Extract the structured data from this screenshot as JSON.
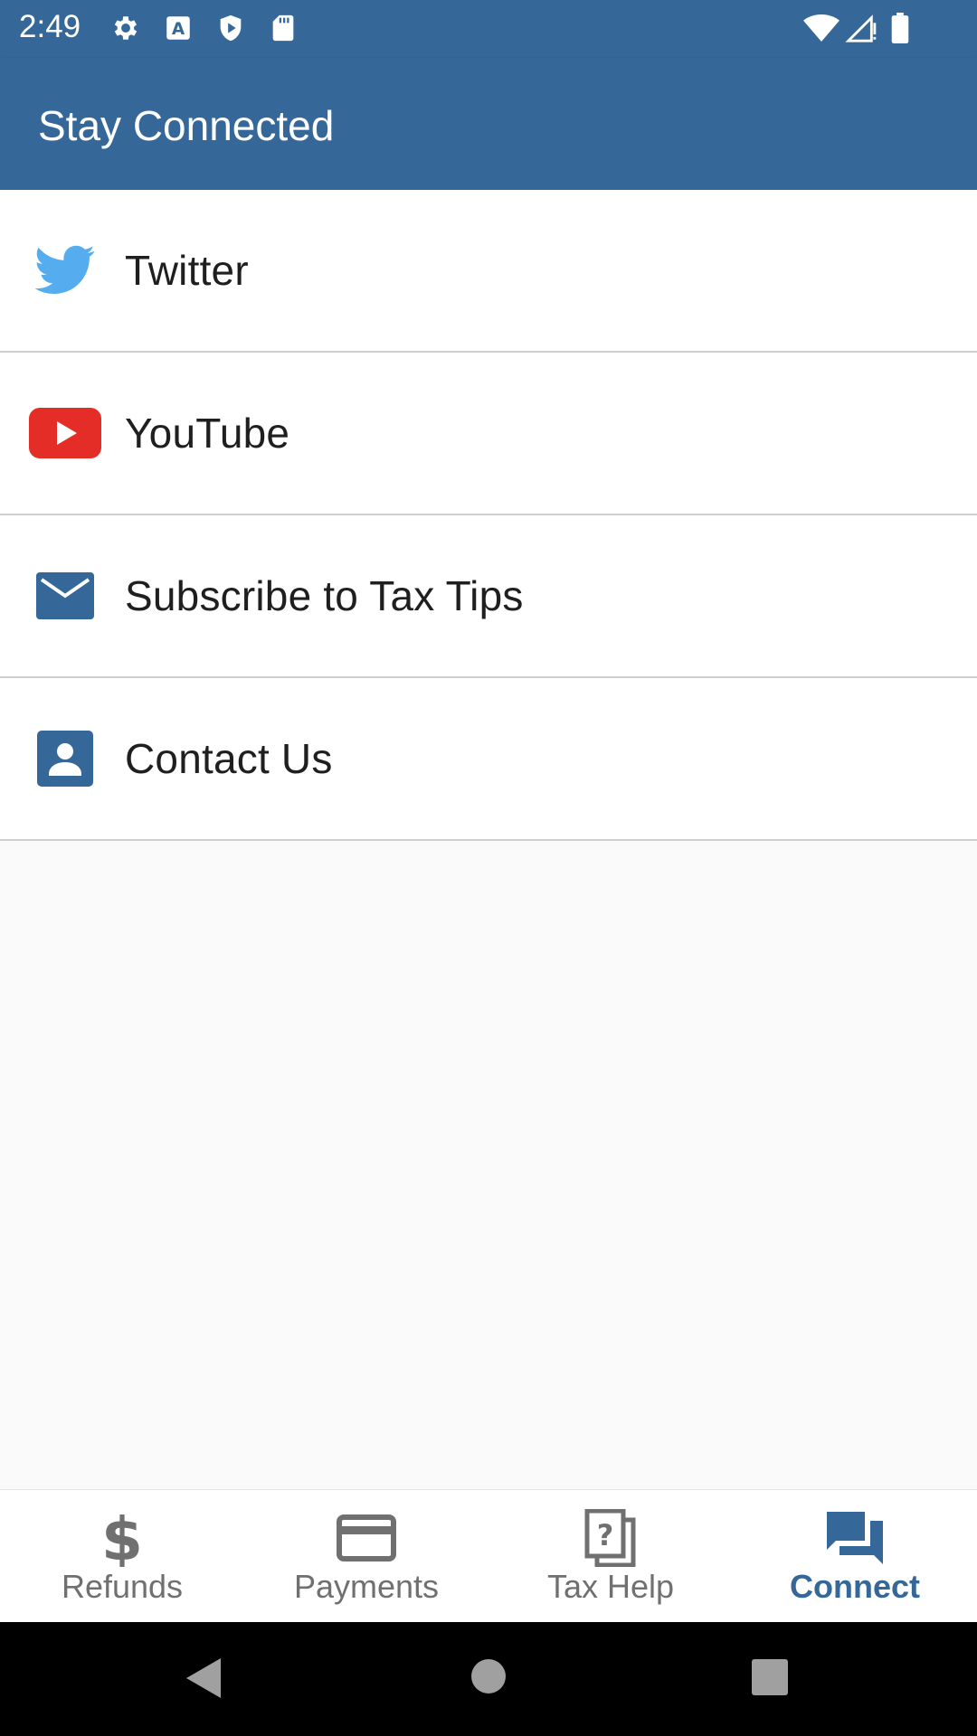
{
  "status_bar": {
    "time": "2:49",
    "icons": [
      "settings-icon",
      "text-a-icon",
      "shield-play-icon",
      "sd-card-icon",
      "wifi-icon",
      "signal-icon",
      "battery-icon"
    ]
  },
  "app_bar": {
    "title": "Stay Connected"
  },
  "list": {
    "items": [
      {
        "label": "Twitter",
        "icon": "twitter-icon"
      },
      {
        "label": "YouTube",
        "icon": "youtube-icon"
      },
      {
        "label": "Subscribe to Tax Tips",
        "icon": "mail-icon"
      },
      {
        "label": "Contact Us",
        "icon": "contact-card-icon"
      }
    ]
  },
  "bottom_nav": {
    "items": [
      {
        "label": "Refunds",
        "icon": "dollar-icon",
        "active": false
      },
      {
        "label": "Payments",
        "icon": "credit-card-icon",
        "active": false
      },
      {
        "label": "Tax Help",
        "icon": "help-document-icon",
        "active": false
      },
      {
        "label": "Connect",
        "icon": "chat-icon",
        "active": true
      }
    ]
  },
  "colors": {
    "primary": "#356899",
    "twitter": "#55acee",
    "youtube": "#e52d27",
    "inactive": "#707070"
  }
}
